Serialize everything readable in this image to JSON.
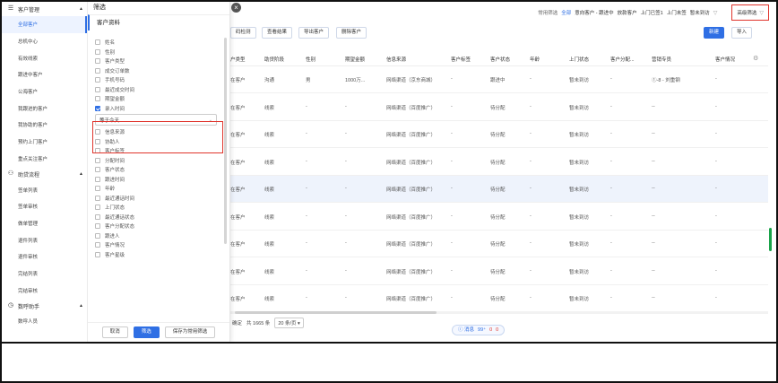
{
  "sidebar": {
    "groups": [
      {
        "label": "客户管理",
        "items": [
          "全部客户",
          "总机中心",
          "有效线索",
          "跟进中客户",
          "公海客户",
          "我跟进的客户",
          "我协助的客户",
          "预约上门客户",
          "重点关注客户"
        ]
      },
      {
        "label": "助贷流程",
        "items": [
          "签单列表",
          "签单审核",
          "做单管理",
          "退件列表",
          "退件审核",
          "完结列表",
          "完结审核"
        ]
      },
      {
        "label": "数呼助手",
        "items": [
          "数呼人员"
        ]
      }
    ]
  },
  "filter": {
    "title": "筛选",
    "section": "客户资料",
    "fields_top": [
      "姓名",
      "性别",
      "客户类型",
      "成交订单数",
      "手机号码",
      "最近成交时间",
      "期望金额"
    ],
    "checked_field": "录入时间",
    "checked_value": "等于今天",
    "fields_bottom": [
      "信息来源",
      "协助人",
      "客户标签",
      "分配时间",
      "客户状态",
      "跟进时间",
      "年龄",
      "最近通话时间",
      "上门状态",
      "最近通话状态",
      "客户分配状态",
      "跟进人",
      "客户情况",
      "客户星级"
    ],
    "cancel": "取消",
    "apply": "筛选",
    "save": "保存为常用筛选"
  },
  "topnav": {
    "common_filter": "常用筛选",
    "all": "全部",
    "links": [
      "意向客户 - 跟进中",
      "放款客户",
      "上门已签1",
      "上门未签",
      "暂未到访"
    ],
    "advanced": "高级筛选"
  },
  "toolbar": {
    "buttons": [
      "码检测",
      "查看结果",
      "导出客户",
      "删除客户"
    ],
    "new": "新建",
    "import": "导入"
  },
  "table": {
    "headers": [
      "户类型",
      "助贷阶段",
      "性别",
      "期望金额",
      "信息来源",
      "客户标签",
      "客户状态",
      "年龄",
      "上门状态",
      "客户分配...",
      "营销专员",
      "客户情况"
    ],
    "rows": [
      [
        "在客户",
        "沟通",
        "男",
        "1000万...",
        "网络渠道（京东商城）",
        "-",
        "跟进中",
        "-",
        "暂未到访",
        "-",
        "①-8 - 刘重钢",
        "-"
      ],
      [
        "在客户",
        "线索",
        "-",
        "-",
        "网络渠道（百度推广）",
        "-",
        "待分配",
        "-",
        "暂未到访",
        "-",
        "--",
        "-"
      ],
      [
        "在客户",
        "线索",
        "-",
        "-",
        "网络渠道（百度推广）",
        "-",
        "待分配",
        "-",
        "暂未到访",
        "-",
        "--",
        "-"
      ],
      [
        "在客户",
        "线索",
        "-",
        "-",
        "网络渠道（百度推广）",
        "-",
        "待分配",
        "-",
        "暂未到访",
        "-",
        "--",
        "-"
      ],
      [
        "在客户",
        "线索",
        "-",
        "-",
        "网络渠道（百度推广）",
        "-",
        "待分配",
        "-",
        "暂未到访",
        "-",
        "--",
        "-"
      ],
      [
        "在客户",
        "线索",
        "-",
        "-",
        "网络渠道（百度推广）",
        "-",
        "待分配",
        "-",
        "暂未到访",
        "-",
        "--",
        "-"
      ],
      [
        "在客户",
        "线索",
        "-",
        "-",
        "网络渠道（百度推广）",
        "-",
        "待分配",
        "-",
        "暂未到访",
        "-",
        "--",
        "-"
      ],
      [
        "在客户",
        "线索",
        "-",
        "-",
        "网络渠道（百度推广）",
        "-",
        "待分配",
        "-",
        "暂未到访",
        "-",
        "--",
        "-"
      ],
      [
        "在客户",
        "线索",
        "-",
        "-",
        "网络渠道（百度推广）",
        "-",
        "待分配",
        "-",
        "暂未到访",
        "-",
        "--",
        "-"
      ]
    ],
    "highlighted_row": 4
  },
  "pager": {
    "confirm": "确定",
    "total": "共 1665 条",
    "per_page": "20 条/页"
  },
  "messages": {
    "label": "消息",
    "count_blue": "99⁺",
    "count_red_1": "0",
    "count_red_2": "0"
  },
  "colors": {
    "accent": "#2f6fe4",
    "highlight_border": "#e0342c",
    "scroll_green": "#1aa34a"
  }
}
